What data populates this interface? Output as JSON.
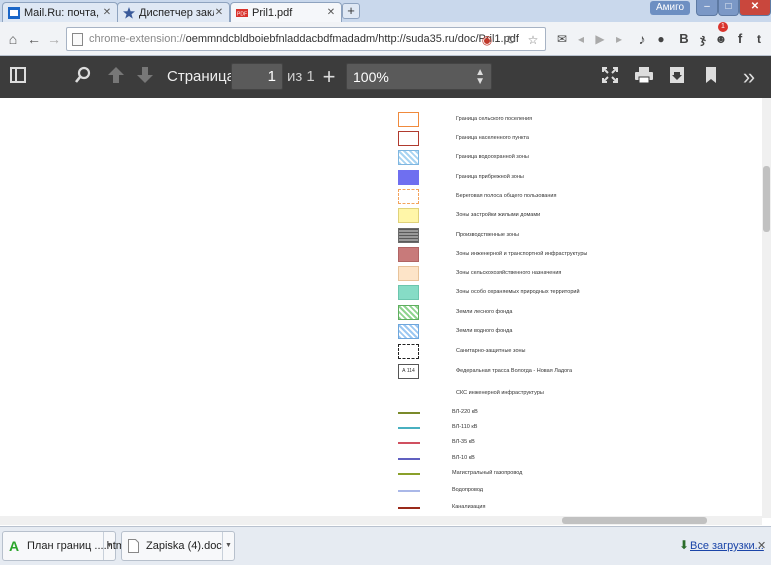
{
  "tabs": [
    {
      "title": "Mail.Ru: почта, поиск",
      "active": false
    },
    {
      "title": "Диспетчер закладок",
      "active": false
    },
    {
      "title": "Pril1.pdf",
      "active": true
    }
  ],
  "new_tab_label": "+",
  "profile_name": "Амиго",
  "window_controls": {
    "minimize": "‒",
    "maximize": "□",
    "close": "✕"
  },
  "address_bar": {
    "url_grey": "chrome-extension://",
    "url": "oemmndcbldboiebfnladdacbdfmadadm/http://suda35.ru/doc/Pril1.pdf"
  },
  "notifications_badge": "1",
  "pdf_toolbar": {
    "page_label": "Страница:",
    "page_current": "1",
    "page_total": "из 1",
    "zoom": "100%"
  },
  "legend": [
    {
      "label": "Граница сельского поселения",
      "kind": "box",
      "fill": "#ffffff",
      "border": "#f08a3c"
    },
    {
      "label": "Граница населенного пункта",
      "kind": "box",
      "fill": "#ffffff",
      "border": "#b03a2e"
    },
    {
      "label": "Граница водоохранной зоны",
      "kind": "pattern",
      "fill": "#a8d4f2",
      "border": "#7fb6e0"
    },
    {
      "label": "Граница прибрежной зоны",
      "kind": "box",
      "fill": "#6f6ff0",
      "border": "#6f6ff0"
    },
    {
      "label": "Береговая полоса общего пользования",
      "kind": "dashed",
      "fill": "#ffffff",
      "border": "#f3a35c"
    },
    {
      "label": "Зоны застройки жилыми домами",
      "kind": "box",
      "fill": "#fff6a8",
      "border": "#e0d27a"
    },
    {
      "label": "Производственные зоны",
      "kind": "grid",
      "fill": "#8a8a8a",
      "border": "#6a6a6a"
    },
    {
      "label": "Зоны инженерной и транспортной инфраструктуры",
      "kind": "box",
      "fill": "#c87a7a",
      "border": "#b06464"
    },
    {
      "label": "Зоны сельскохозяйственного назначения",
      "kind": "box",
      "fill": "#fde4c8",
      "border": "#e8c39a"
    },
    {
      "label": "Зоны особо охраняемых природных территорий",
      "kind": "box",
      "fill": "#86dcc6",
      "border": "#6cc6ae"
    },
    {
      "label": "Земли лесного фонда",
      "kind": "pattern",
      "fill": "#8fd48f",
      "border": "#5fae5f"
    },
    {
      "label": "Земли водного фонда",
      "kind": "pattern",
      "fill": "#9cc8f2",
      "border": "#6ea6dc"
    },
    {
      "label": "Санитарно-защитные зоны",
      "kind": "dashed",
      "fill": "#ffffff",
      "border": "#222222"
    },
    {
      "label": "Федеральная трасса Вологда - Новая Ладога",
      "kind": "sign",
      "fill": "#ffffff",
      "border": "#555555",
      "sign_text": "А 114"
    },
    {
      "label": "СКС инженерной инфраструктуры",
      "kind": "none"
    },
    {
      "label": "ВЛ-220 кВ",
      "kind": "line",
      "color": "#7a8a2a"
    },
    {
      "label": "ВЛ-110 кВ",
      "kind": "line",
      "color": "#48b0c0"
    },
    {
      "label": "ВЛ-35 кВ",
      "kind": "line",
      "color": "#d05060"
    },
    {
      "label": "ВЛ-10 кВ",
      "kind": "line",
      "color": "#6060c0"
    },
    {
      "label": "Магистральный газопровод",
      "kind": "line",
      "color": "#8aa02a"
    },
    {
      "label": "Водопровод",
      "kind": "line",
      "color": "#aab8e8"
    },
    {
      "label": "Канализация",
      "kind": "line",
      "color": "#9a2a1a"
    }
  ],
  "downloads": [
    {
      "name": "План границ ....htm",
      "icon": "amigo-file-icon"
    },
    {
      "name": "Zapiska (4).doc",
      "icon": "doc-file-icon"
    }
  ],
  "all_downloads_label": "Все загрузки...",
  "icons": [
    "home-icon",
    "back-icon",
    "forward-icon",
    "mail-icon",
    "music-icon",
    "chat-icon",
    "vk-icon",
    "ok-icon",
    "friends-icon",
    "facebook-icon",
    "twitter-icon"
  ]
}
